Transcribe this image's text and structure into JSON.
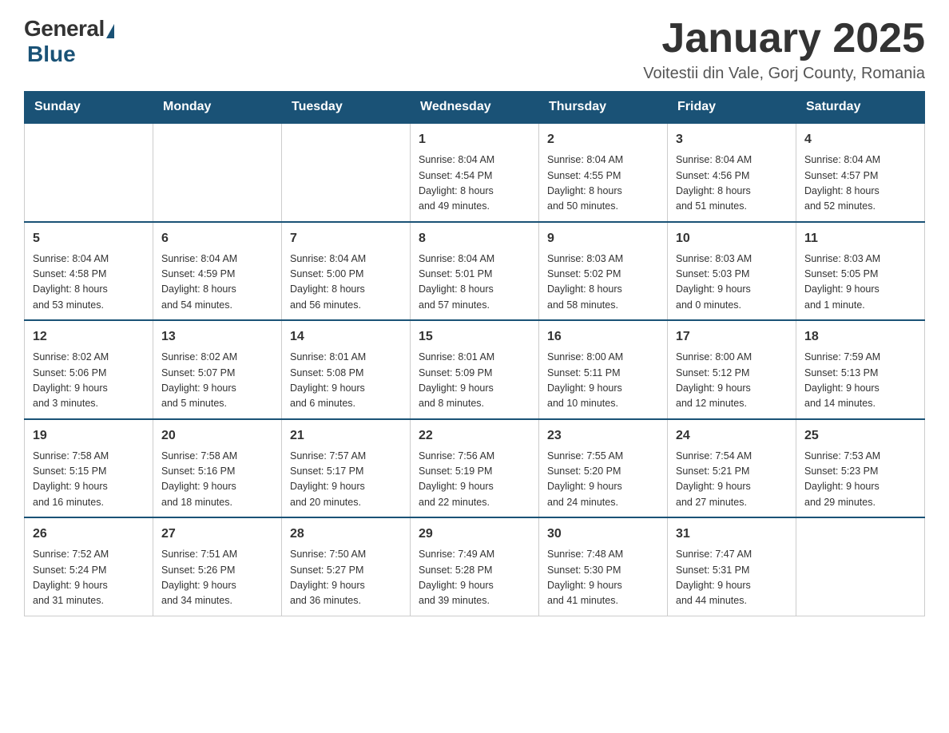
{
  "header": {
    "logo_general": "General",
    "logo_blue": "Blue",
    "month_title": "January 2025",
    "location": "Voitestii din Vale, Gorj County, Romania"
  },
  "weekdays": [
    "Sunday",
    "Monday",
    "Tuesday",
    "Wednesday",
    "Thursday",
    "Friday",
    "Saturday"
  ],
  "weeks": [
    [
      {
        "day": "",
        "info": ""
      },
      {
        "day": "",
        "info": ""
      },
      {
        "day": "",
        "info": ""
      },
      {
        "day": "1",
        "info": "Sunrise: 8:04 AM\nSunset: 4:54 PM\nDaylight: 8 hours\nand 49 minutes."
      },
      {
        "day": "2",
        "info": "Sunrise: 8:04 AM\nSunset: 4:55 PM\nDaylight: 8 hours\nand 50 minutes."
      },
      {
        "day": "3",
        "info": "Sunrise: 8:04 AM\nSunset: 4:56 PM\nDaylight: 8 hours\nand 51 minutes."
      },
      {
        "day": "4",
        "info": "Sunrise: 8:04 AM\nSunset: 4:57 PM\nDaylight: 8 hours\nand 52 minutes."
      }
    ],
    [
      {
        "day": "5",
        "info": "Sunrise: 8:04 AM\nSunset: 4:58 PM\nDaylight: 8 hours\nand 53 minutes."
      },
      {
        "day": "6",
        "info": "Sunrise: 8:04 AM\nSunset: 4:59 PM\nDaylight: 8 hours\nand 54 minutes."
      },
      {
        "day": "7",
        "info": "Sunrise: 8:04 AM\nSunset: 5:00 PM\nDaylight: 8 hours\nand 56 minutes."
      },
      {
        "day": "8",
        "info": "Sunrise: 8:04 AM\nSunset: 5:01 PM\nDaylight: 8 hours\nand 57 minutes."
      },
      {
        "day": "9",
        "info": "Sunrise: 8:03 AM\nSunset: 5:02 PM\nDaylight: 8 hours\nand 58 minutes."
      },
      {
        "day": "10",
        "info": "Sunrise: 8:03 AM\nSunset: 5:03 PM\nDaylight: 9 hours\nand 0 minutes."
      },
      {
        "day": "11",
        "info": "Sunrise: 8:03 AM\nSunset: 5:05 PM\nDaylight: 9 hours\nand 1 minute."
      }
    ],
    [
      {
        "day": "12",
        "info": "Sunrise: 8:02 AM\nSunset: 5:06 PM\nDaylight: 9 hours\nand 3 minutes."
      },
      {
        "day": "13",
        "info": "Sunrise: 8:02 AM\nSunset: 5:07 PM\nDaylight: 9 hours\nand 5 minutes."
      },
      {
        "day": "14",
        "info": "Sunrise: 8:01 AM\nSunset: 5:08 PM\nDaylight: 9 hours\nand 6 minutes."
      },
      {
        "day": "15",
        "info": "Sunrise: 8:01 AM\nSunset: 5:09 PM\nDaylight: 9 hours\nand 8 minutes."
      },
      {
        "day": "16",
        "info": "Sunrise: 8:00 AM\nSunset: 5:11 PM\nDaylight: 9 hours\nand 10 minutes."
      },
      {
        "day": "17",
        "info": "Sunrise: 8:00 AM\nSunset: 5:12 PM\nDaylight: 9 hours\nand 12 minutes."
      },
      {
        "day": "18",
        "info": "Sunrise: 7:59 AM\nSunset: 5:13 PM\nDaylight: 9 hours\nand 14 minutes."
      }
    ],
    [
      {
        "day": "19",
        "info": "Sunrise: 7:58 AM\nSunset: 5:15 PM\nDaylight: 9 hours\nand 16 minutes."
      },
      {
        "day": "20",
        "info": "Sunrise: 7:58 AM\nSunset: 5:16 PM\nDaylight: 9 hours\nand 18 minutes."
      },
      {
        "day": "21",
        "info": "Sunrise: 7:57 AM\nSunset: 5:17 PM\nDaylight: 9 hours\nand 20 minutes."
      },
      {
        "day": "22",
        "info": "Sunrise: 7:56 AM\nSunset: 5:19 PM\nDaylight: 9 hours\nand 22 minutes."
      },
      {
        "day": "23",
        "info": "Sunrise: 7:55 AM\nSunset: 5:20 PM\nDaylight: 9 hours\nand 24 minutes."
      },
      {
        "day": "24",
        "info": "Sunrise: 7:54 AM\nSunset: 5:21 PM\nDaylight: 9 hours\nand 27 minutes."
      },
      {
        "day": "25",
        "info": "Sunrise: 7:53 AM\nSunset: 5:23 PM\nDaylight: 9 hours\nand 29 minutes."
      }
    ],
    [
      {
        "day": "26",
        "info": "Sunrise: 7:52 AM\nSunset: 5:24 PM\nDaylight: 9 hours\nand 31 minutes."
      },
      {
        "day": "27",
        "info": "Sunrise: 7:51 AM\nSunset: 5:26 PM\nDaylight: 9 hours\nand 34 minutes."
      },
      {
        "day": "28",
        "info": "Sunrise: 7:50 AM\nSunset: 5:27 PM\nDaylight: 9 hours\nand 36 minutes."
      },
      {
        "day": "29",
        "info": "Sunrise: 7:49 AM\nSunset: 5:28 PM\nDaylight: 9 hours\nand 39 minutes."
      },
      {
        "day": "30",
        "info": "Sunrise: 7:48 AM\nSunset: 5:30 PM\nDaylight: 9 hours\nand 41 minutes."
      },
      {
        "day": "31",
        "info": "Sunrise: 7:47 AM\nSunset: 5:31 PM\nDaylight: 9 hours\nand 44 minutes."
      },
      {
        "day": "",
        "info": ""
      }
    ]
  ]
}
